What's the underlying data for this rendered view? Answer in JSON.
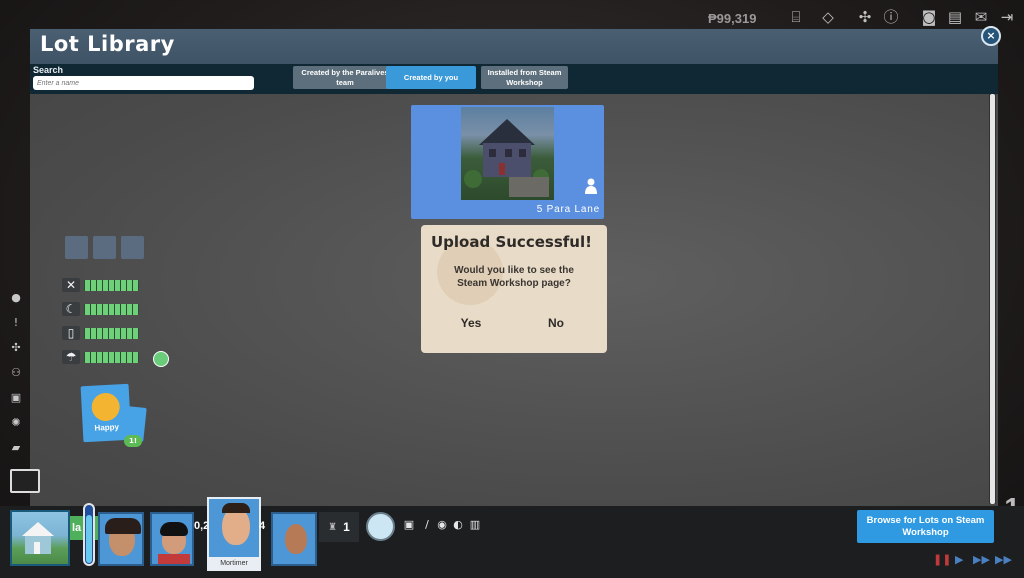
{
  "hud": {
    "money": "₱99,319",
    "icons": [
      "stairs-icon",
      "rotate-icon",
      "tools-icon",
      "info-icon",
      "camera-icon",
      "newspaper-icon",
      "mail-icon",
      "exit-icon"
    ]
  },
  "library": {
    "title": "Lot Library",
    "search": {
      "label": "Search",
      "placeholder": "Enter a name"
    },
    "tabs": [
      {
        "label": "Created by the Paralives team",
        "active": false
      },
      {
        "label": "Created by you",
        "active": true
      },
      {
        "label": "Installed from Steam Workshop",
        "active": false
      }
    ],
    "close_label": "×"
  },
  "lot": {
    "name": "5 Para Lane"
  },
  "dialog": {
    "title": "Upload Successful!",
    "message": "Would you like to see the Steam Workshop page?",
    "yes_label": "Yes",
    "no_label": "No"
  },
  "needs": [
    {
      "icon": "food-icon",
      "level": 0.95
    },
    {
      "icon": "sleep-icon",
      "level": 0.95
    },
    {
      "icon": "toilet-icon",
      "level": 0.95
    },
    {
      "icon": "shower-icon",
      "level": 0.95
    }
  ],
  "mood": {
    "label": "Happy",
    "badge": "1!"
  },
  "bottom": {
    "lot_partial_label": "la",
    "partial_value_1": "0,2",
    "partial_value_2": "4",
    "counter_value": "1",
    "portrait_name": "Mortimer",
    "browse_label": "Browse for Lots on Steam Workshop",
    "energy_level": 0.85
  },
  "right_rail_number": "1",
  "colors": {
    "accent_blue": "#3a99d8",
    "dialog_bg": "#e8dcc8",
    "need_green": "#6fd07a",
    "header_blue": "#4b5f72"
  }
}
